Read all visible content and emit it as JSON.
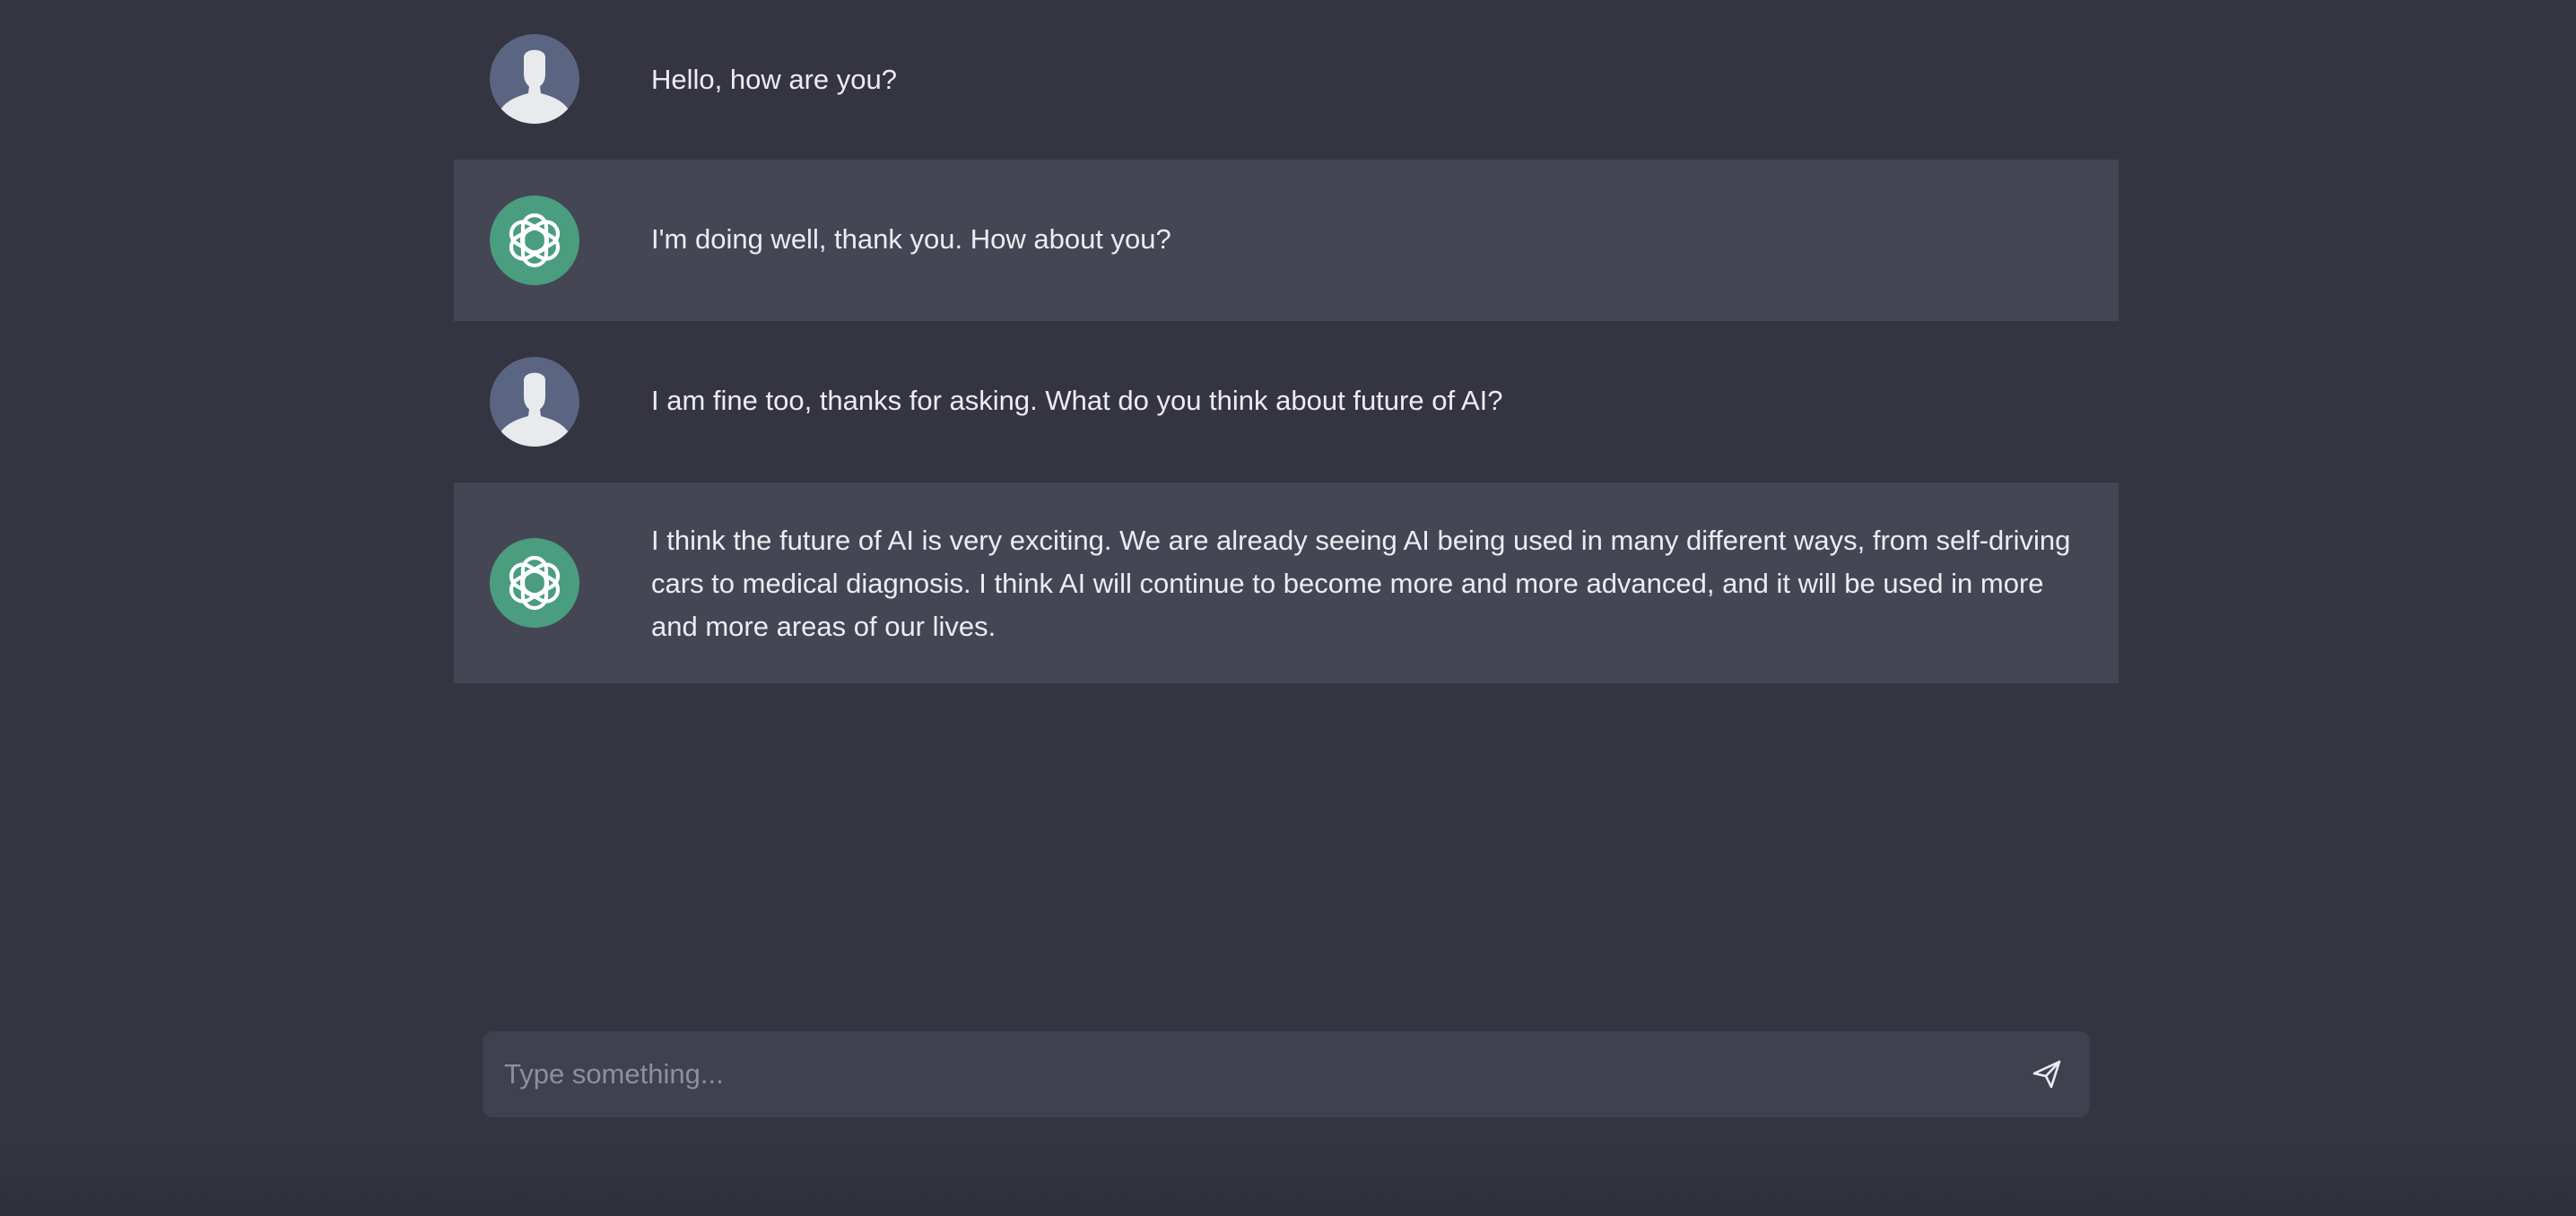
{
  "colors": {
    "background": "#343541",
    "assistant_row": "#444654",
    "input_bg": "#40414f",
    "user_avatar": "#5a6582",
    "bot_avatar": "#4a9d7f",
    "text": "#ececf1",
    "placeholder": "#8e8ea0"
  },
  "messages": [
    {
      "role": "user",
      "avatar_icon": "user-silhouette-icon",
      "text": "Hello, how are you?"
    },
    {
      "role": "assistant",
      "avatar_icon": "openai-logo-icon",
      "text": "I'm doing well, thank you. How about you?"
    },
    {
      "role": "user",
      "avatar_icon": "user-silhouette-icon",
      "text": "I am fine too, thanks for asking. What do you think about future of AI?"
    },
    {
      "role": "assistant",
      "avatar_icon": "openai-logo-icon",
      "text": "I think the future of AI is very exciting. We are already seeing AI being used in many different ways, from self-driving cars to medical diagnosis. I think AI will continue to become more and more advanced, and it will be used in more and more areas of our lives."
    }
  ],
  "composer": {
    "placeholder": "Type something...",
    "value": "",
    "send_icon": "send-icon"
  }
}
